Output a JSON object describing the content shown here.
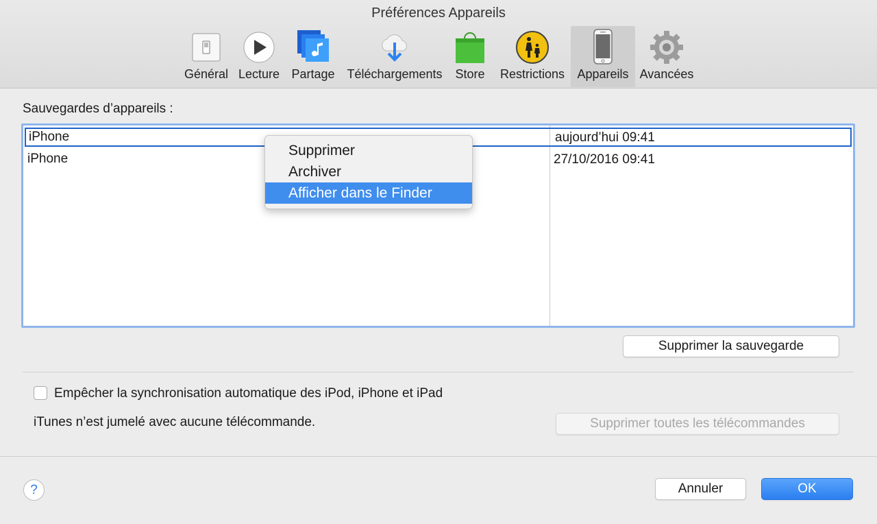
{
  "window": {
    "title": "Préférences Appareils"
  },
  "tabs": [
    {
      "label": "Général",
      "icon": "general-switch-icon"
    },
    {
      "label": "Lecture",
      "icon": "play-icon"
    },
    {
      "label": "Partage",
      "icon": "music-share-icon"
    },
    {
      "label": "Téléchargements",
      "icon": "cloud-download-icon"
    },
    {
      "label": "Store",
      "icon": "shopping-bag-icon"
    },
    {
      "label": "Restrictions",
      "icon": "parental-restrictions-icon"
    },
    {
      "label": "Appareils",
      "icon": "iphone-icon",
      "active": true
    },
    {
      "label": "Avancées",
      "icon": "gear-icon"
    }
  ],
  "backups": {
    "label": "Sauvegardes d’appareils :",
    "rows": [
      {
        "device": "iPhone",
        "date": "aujourd’hui 09:41",
        "selected": true
      },
      {
        "device": "iPhone",
        "date": "27/10/2016 09:41",
        "selected": false
      }
    ]
  },
  "context_menu": {
    "items": [
      {
        "label": "Supprimer",
        "highlighted": false
      },
      {
        "label": "Archiver",
        "highlighted": false
      },
      {
        "label": "Afficher dans le Finder",
        "highlighted": true
      }
    ]
  },
  "buttons": {
    "delete_backup": "Supprimer la sauvegarde",
    "delete_remotes": "Supprimer toutes les télécommandes",
    "cancel": "Annuler",
    "ok": "OK",
    "help": "?"
  },
  "options": {
    "prevent_sync_label": "Empêcher la synchronisation automatique des iPod, iPhone et iPad",
    "prevent_sync_checked": false,
    "remote_info": "iTunes n’est jumelé avec aucune télécommande."
  },
  "colors": {
    "accent": "#3f8ded",
    "selection_border": "#1f62c8",
    "table_focus": "#8fb5ec"
  }
}
